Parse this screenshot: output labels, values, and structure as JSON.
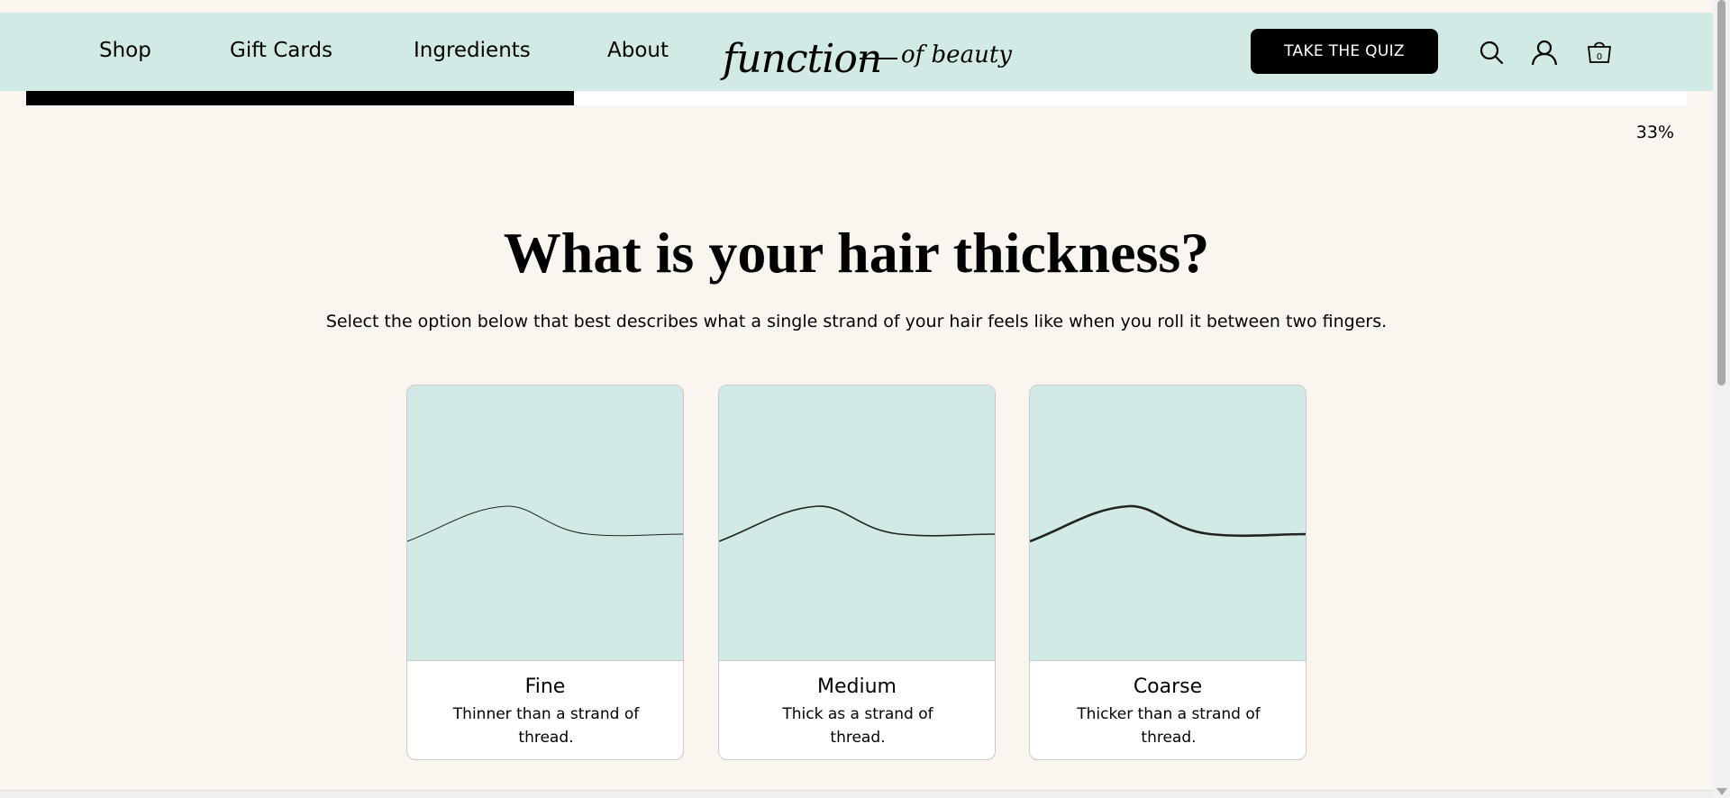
{
  "nav": {
    "links": [
      "Shop",
      "Gift Cards",
      "Ingredients",
      "About"
    ],
    "logo_main": "function",
    "logo_sub": "of beauty",
    "cta_label": "TAKE THE QUIZ",
    "cart_count": "0",
    "icons": [
      "search-icon",
      "account-icon",
      "cart-icon"
    ]
  },
  "progress": {
    "value": 0.33,
    "label": "33%"
  },
  "question": {
    "title": "What is your hair thickness?",
    "subtitle": "Select the option below that best describes what a single strand of your hair feels like when you roll it between two fingers."
  },
  "options": [
    {
      "title": "Fine",
      "desc": "Thinner than a strand of thread.",
      "stroke": 1
    },
    {
      "title": "Medium",
      "desc": "Thick as a strand of thread.",
      "stroke": 1.6
    },
    {
      "title": "Coarse",
      "desc": "Thicker than a strand of thread.",
      "stroke": 2.6
    }
  ],
  "colors": {
    "nav_bg": "#D2EAE5",
    "page_bg": "#FAF5EF",
    "card_image_bg": "#D2EAE5",
    "accent": "#000000"
  }
}
